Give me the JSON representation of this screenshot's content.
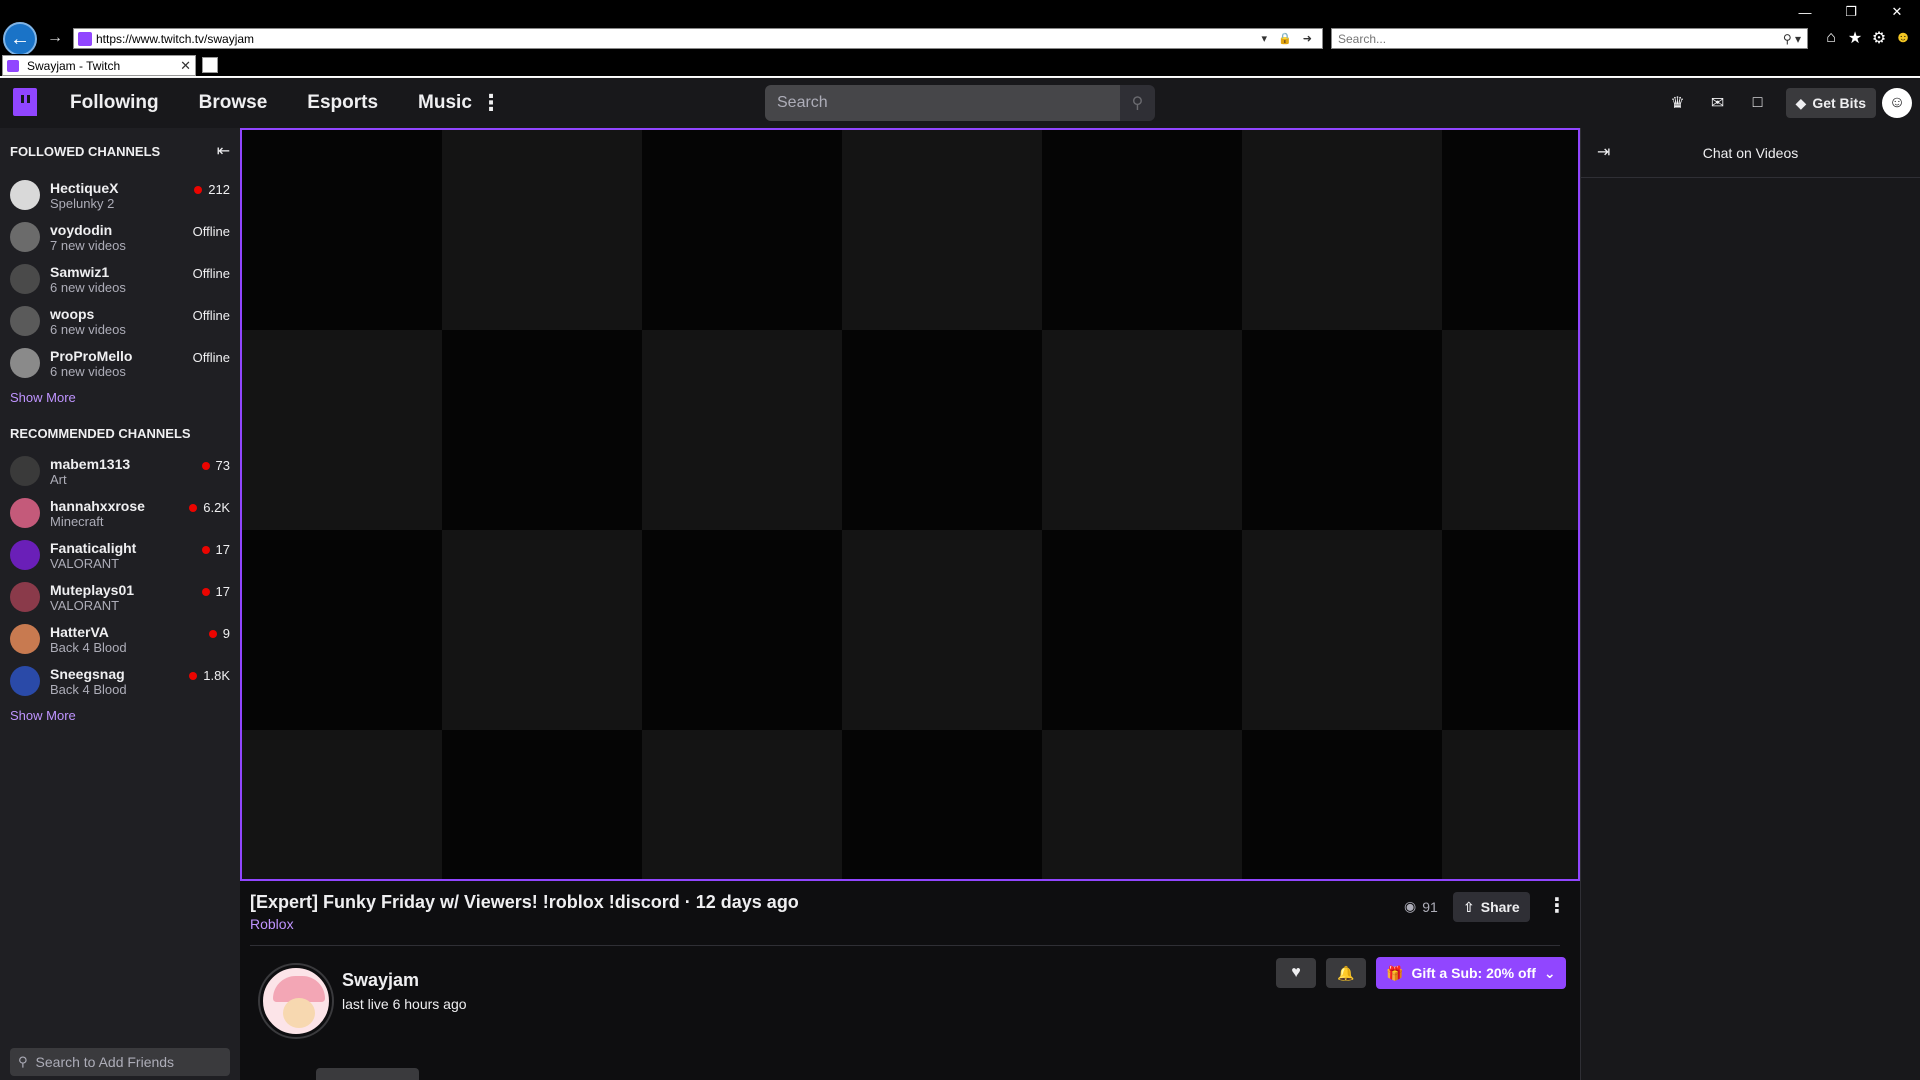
{
  "browser": {
    "url": "https://www.twitch.tv/swayjam",
    "search_placeholder": "Search...",
    "tab_title": "Swayjam - Twitch"
  },
  "nav": {
    "links": [
      "Following",
      "Browse",
      "Esports",
      "Music"
    ],
    "search_placeholder": "Search",
    "get_bits": "Get Bits"
  },
  "sidebar": {
    "followed_header": "FOLLOWED CHANNELS",
    "followed": [
      {
        "name": "HectiqueX",
        "sub": "Spelunky 2",
        "live": true,
        "status": "212",
        "avatar_color": "#d9d9d9"
      },
      {
        "name": "voydodin",
        "sub": "7 new videos",
        "live": false,
        "status": "Offline",
        "avatar_color": "#6b6b6b"
      },
      {
        "name": "Samwiz1",
        "sub": "6 new videos",
        "live": false,
        "status": "Offline",
        "avatar_color": "#4a4a4a"
      },
      {
        "name": "woops",
        "sub": "6 new videos",
        "live": false,
        "status": "Offline",
        "avatar_color": "#5a5a5a"
      },
      {
        "name": "ProProMello",
        "sub": "6 new videos",
        "live": false,
        "status": "Offline",
        "avatar_color": "#8a8a8a"
      }
    ],
    "show_more": "Show More",
    "recommended_header": "RECOMMENDED CHANNELS",
    "recommended": [
      {
        "name": "mabem1313",
        "sub": "Art",
        "live": true,
        "status": "73",
        "avatar_color": "#3a3a3a"
      },
      {
        "name": "hannahxxrose",
        "sub": "Minecraft",
        "live": true,
        "status": "6.2K",
        "avatar_color": "#c45a7a"
      },
      {
        "name": "Fanaticalight",
        "sub": "VALORANT",
        "live": true,
        "status": "17",
        "avatar_color": "#6a1fb8"
      },
      {
        "name": "Muteplays01",
        "sub": "VALORANT",
        "live": true,
        "status": "17",
        "avatar_color": "#8a3a4a"
      },
      {
        "name": "HatterVA",
        "sub": "Back 4 Blood",
        "live": true,
        "status": "9",
        "avatar_color": "#c87a50"
      },
      {
        "name": "Sneegsnag",
        "sub": "Back 4 Blood",
        "live": true,
        "status": "1.8K",
        "avatar_color": "#2a4aa8"
      }
    ],
    "show_more_2": "Show More",
    "friends_search_placeholder": "Search to Add Friends"
  },
  "video": {
    "title": "[Expert] Funky Friday w/ Viewers! !roblox !discord · 12 days ago",
    "category": "Roblox",
    "views": "91",
    "share": "Share"
  },
  "channel": {
    "name": "Swayjam",
    "last_live": "last live 6 hours ago",
    "gift_label": "Gift a Sub: 20% off"
  },
  "chat": {
    "title": "Chat on Videos"
  }
}
